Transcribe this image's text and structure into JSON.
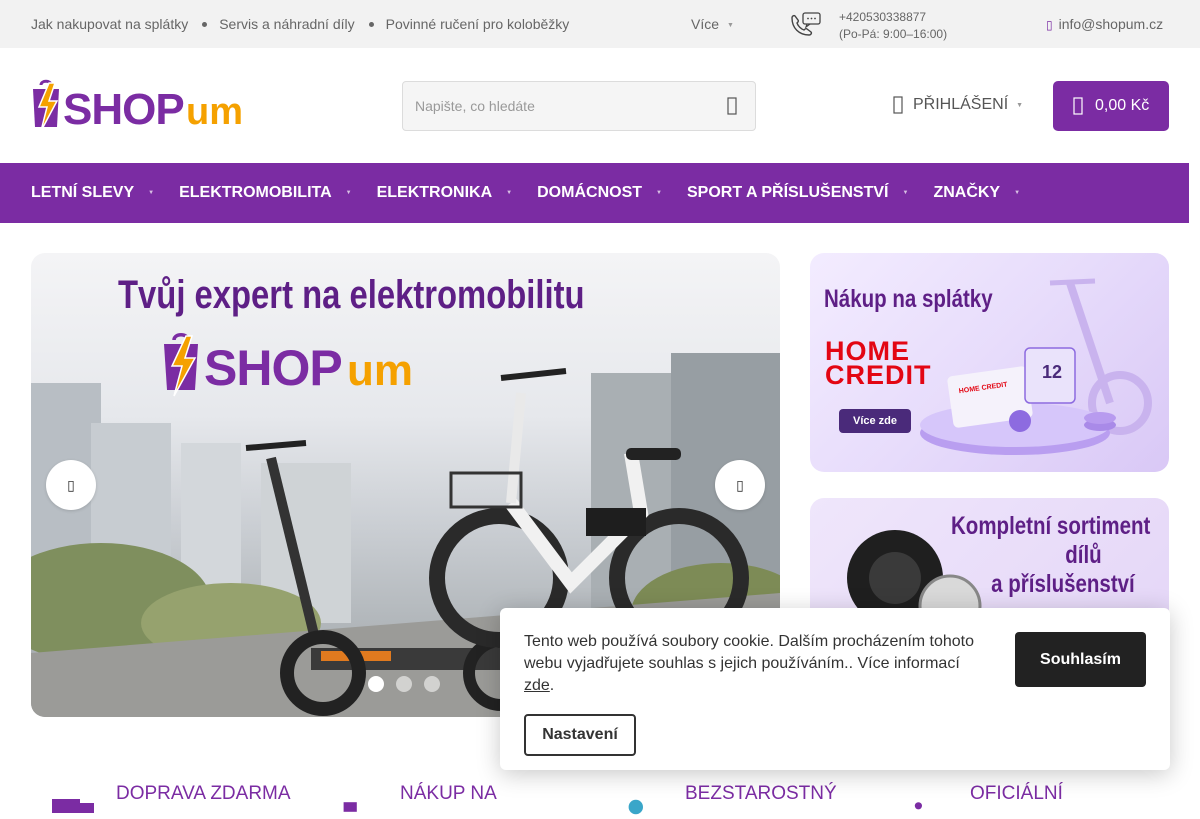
{
  "topbar": {
    "links": [
      "Jak nakupovat na splátky",
      "Servis a náhradní díly",
      "Povinné ručení pro koloběžky"
    ],
    "more_label": "Více",
    "phone_number": "+420530338877",
    "phone_hours": "(Po-Pá: 9:00–16:00)",
    "email": "info@shopum.cz"
  },
  "header": {
    "logo_text": "SHOPum",
    "search_placeholder": "Napište, co hledáte",
    "login_label": "PŘIHLÁŠENÍ",
    "cart_total": "0,00 Kč"
  },
  "nav": {
    "items": [
      "LETNÍ SLEVY",
      "ELEKTROMOBILITA",
      "ELEKTRONIKA",
      "DOMÁCNOST",
      "SPORT A PŘÍSLUŠENSTVÍ",
      "ZNAČKY"
    ]
  },
  "hero": {
    "headline": "Tvůj expert na elektromobilitu",
    "logo_text": "SHOPum",
    "slides_count": 3,
    "active_slide": 1
  },
  "banners": {
    "installments": {
      "title": "Nákup na splátky",
      "brand_line1": "HOME",
      "brand_line2": "CREDIT",
      "button_label": "Více zde"
    },
    "parts": {
      "title_lines": [
        "Kompletní sortiment",
        "dílů",
        "a příslušenství"
      ]
    }
  },
  "cookie": {
    "text": "Tento web používá soubory cookie. Dalším procházením tohoto webu vyjadřujete souhlas s jejich používáním.. Více informací",
    "link_label": "zde",
    "accept_label": "Souhlasím",
    "settings_label": "Nastavení"
  },
  "benefits": [
    "DOPRAVA ZDARMA",
    "NÁKUP NA",
    "BEZSTAROSTNÝ",
    "OFICIÁLNÍ"
  ],
  "colors": {
    "brand_purple": "#7b2ca3",
    "logo_orange": "#f5a100",
    "topbar_bg": "#f2f2f2"
  }
}
